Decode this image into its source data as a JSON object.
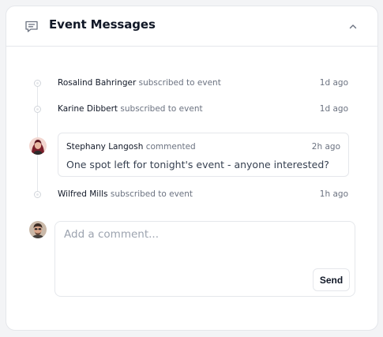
{
  "header": {
    "title": "Event Messages",
    "icon": "message-square-icon",
    "collapse_icon": "chevron-up-icon"
  },
  "timeline": [
    {
      "type": "activity",
      "user": "Rosalind Bahringer",
      "action": "subscribed to event",
      "time": "1d ago"
    },
    {
      "type": "activity",
      "user": "Karine Dibbert",
      "action": "subscribed to event",
      "time": "1d ago"
    },
    {
      "type": "comment",
      "user": "Stephany Langosh",
      "action": "commented",
      "time": "2h ago",
      "text": "One spot left for tonight's event - anyone interested?"
    },
    {
      "type": "activity",
      "user": "Wilfred Mills",
      "action": "subscribed to event",
      "time": "1h ago"
    }
  ],
  "composer": {
    "placeholder": "Add a comment...",
    "send_label": "Send"
  }
}
